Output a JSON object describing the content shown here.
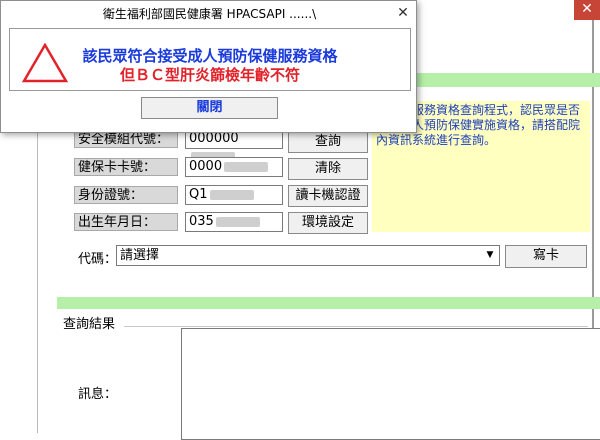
{
  "dialog": {
    "title": "衛生福利部國民健康署 HPACSAPI ......\\",
    "close_glyph": "✕",
    "message_line1": "該民眾符合接受成人預防保健服務資格",
    "message_line2": "但ＢＣ型肝炎篩檢年齡不符",
    "ok_button": "關閉",
    "icon": "warning-triangle-icon"
  },
  "main": {
    "close_glyph": "✕",
    "fields": [
      {
        "label": "安全模組代號：",
        "value": "000000"
      },
      {
        "label": "健保卡卡號：",
        "value": "0000"
      },
      {
        "label": "身份證號：",
        "value": "Q1"
      },
      {
        "label": "出生年月日：",
        "value": "035"
      }
    ],
    "buttons": {
      "query": "查詢",
      "clear": "清除",
      "read_card": "讀卡機認證",
      "settings": "環境設定"
    },
    "info_text": "防保健服務資格查詢程式，認民眾是否符合成人預防保健實施資格，請搭配院內資訊系統進行查詢。",
    "code_label": "代碼：",
    "code_select_value": "請選擇",
    "write_card_button": "寫卡",
    "result_label": "查詢結果",
    "message_label": "訊息："
  },
  "colors": {
    "green_band": "#b6efa7",
    "info_bg": "#ffffc0",
    "info_text": "#1f3fbf",
    "msg_blue": "#1a3adb",
    "msg_red": "#e2222a",
    "close_red": "#c74536"
  }
}
